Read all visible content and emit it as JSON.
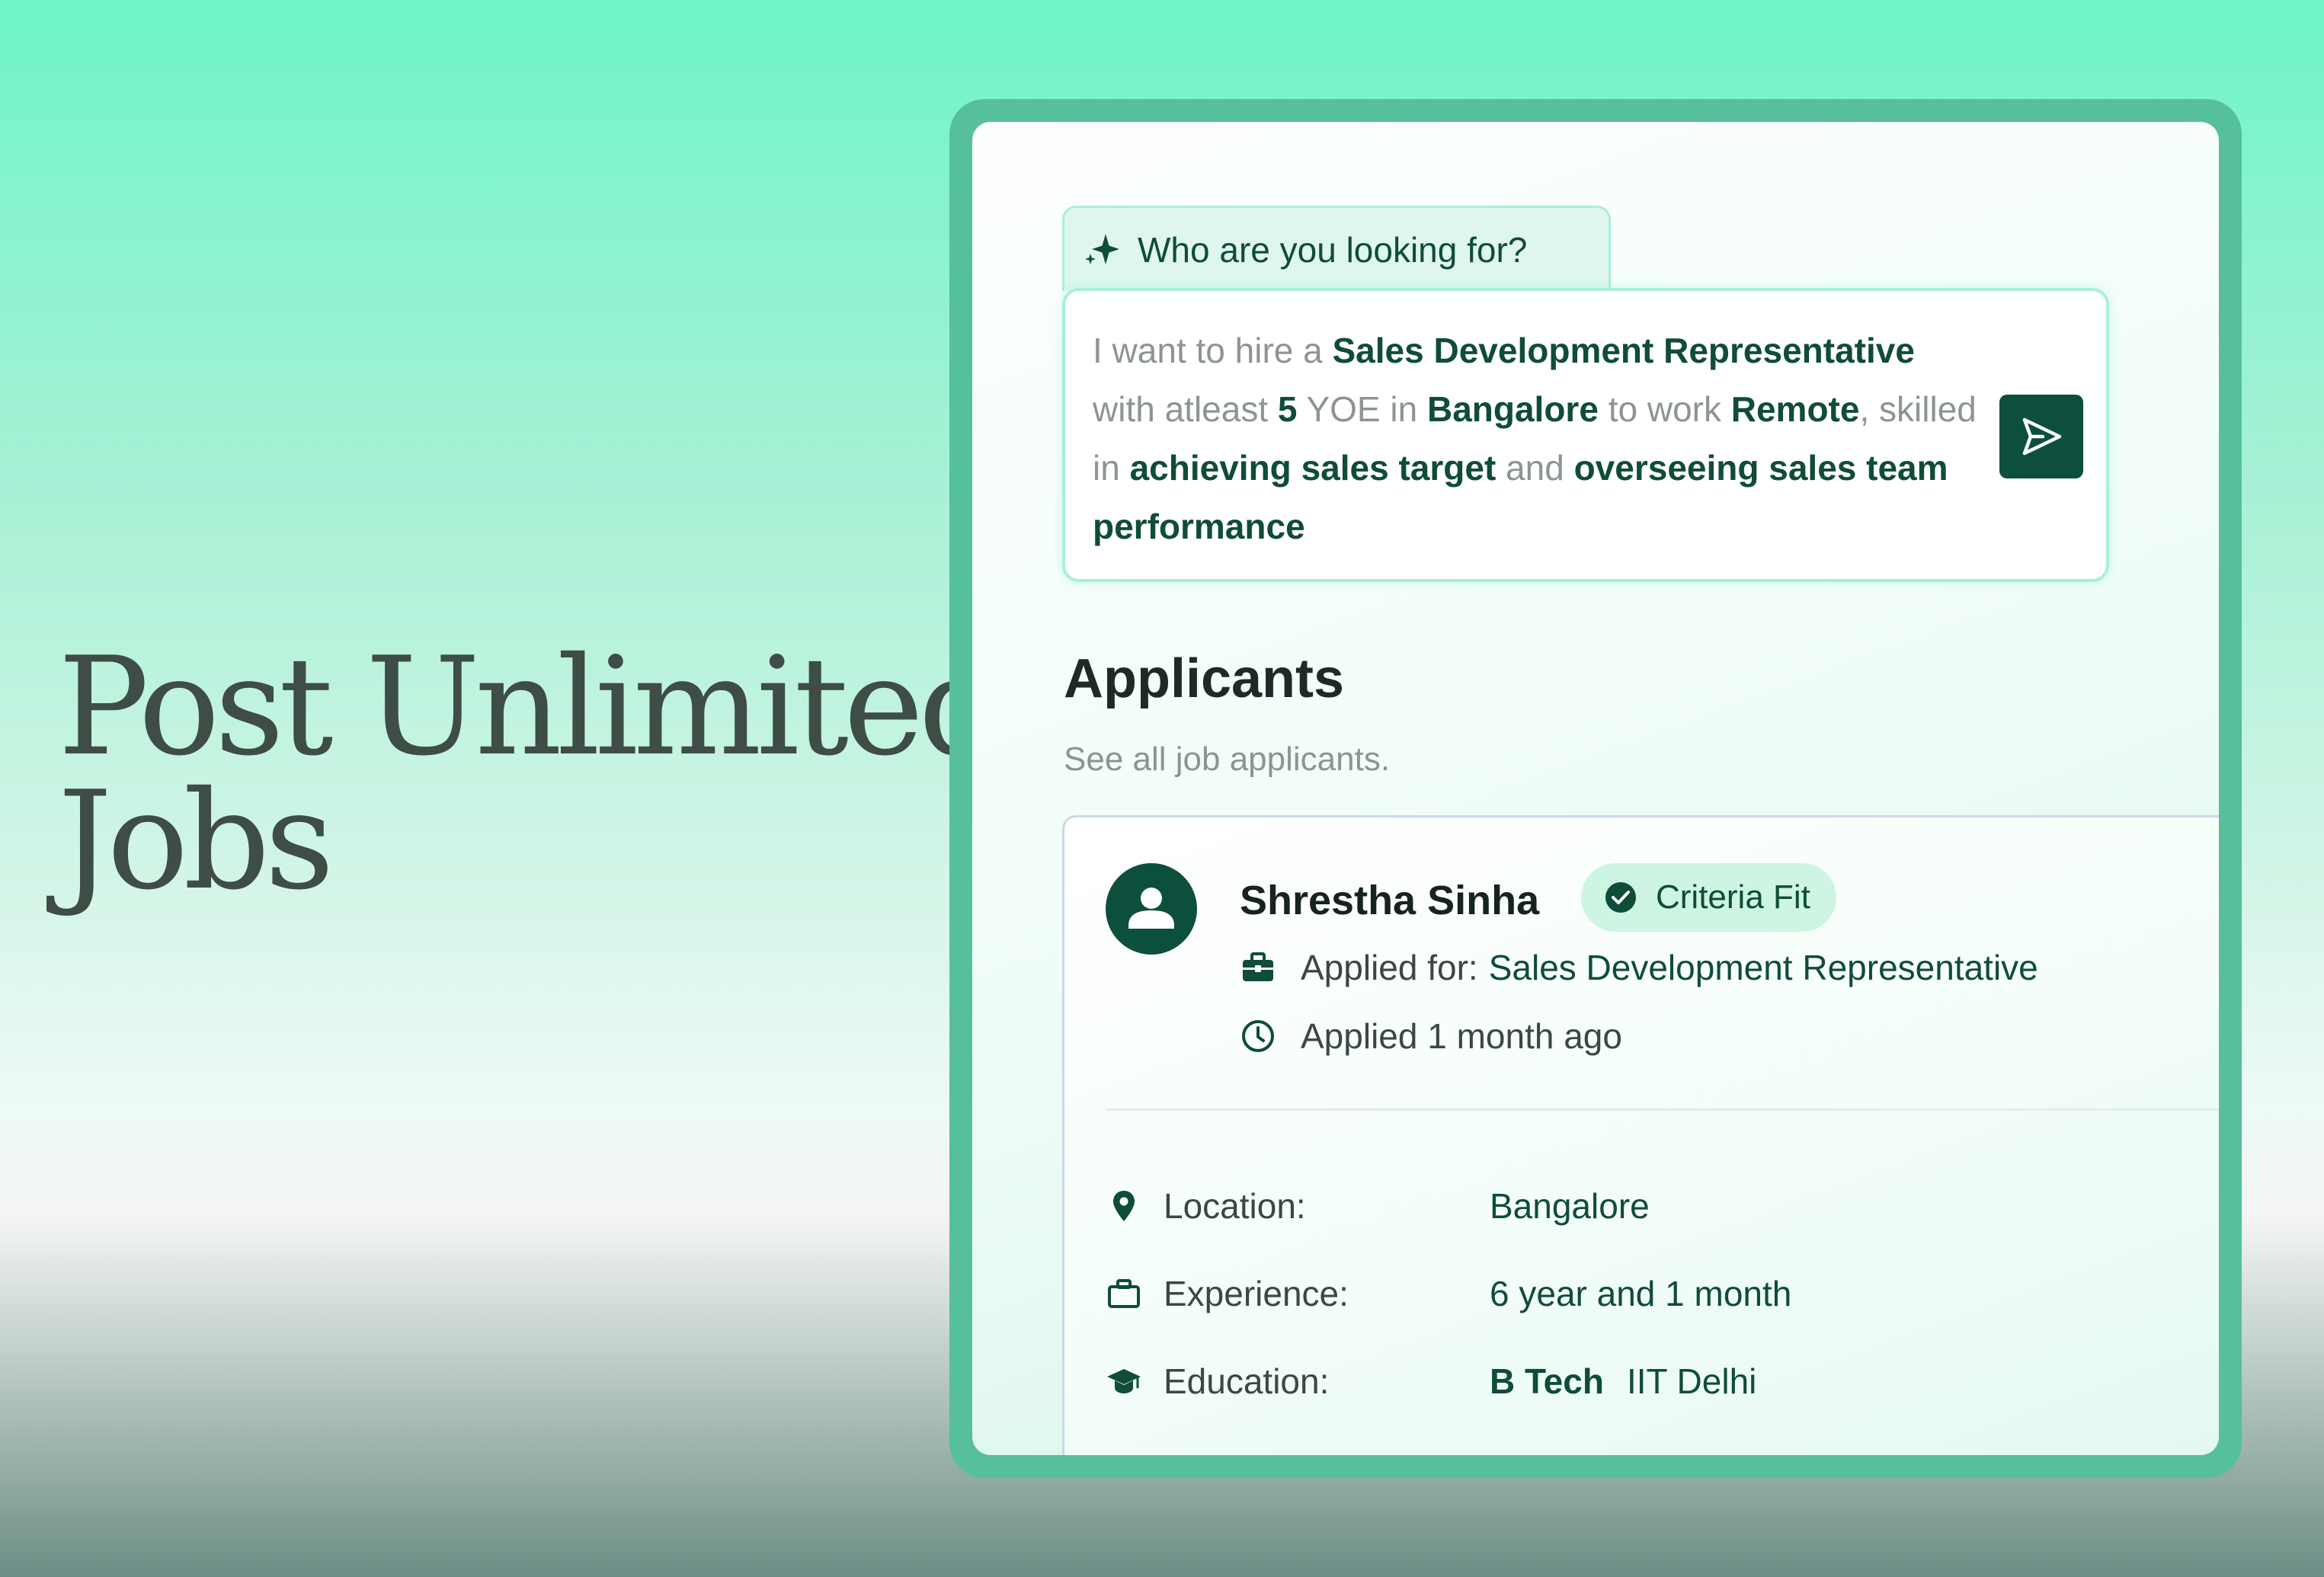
{
  "hero": {
    "line1": "Post Unlimited",
    "line2": "Jobs"
  },
  "prompt": {
    "tab_label": "Who are you looking for?",
    "segments": [
      {
        "text": "I want to hire a ",
        "bold": false
      },
      {
        "text": "Sales Development Representative",
        "bold": true
      },
      {
        "text": " with atleast ",
        "bold": false
      },
      {
        "text": "5",
        "bold": true
      },
      {
        "text": " YOE in ",
        "bold": false
      },
      {
        "text": "Bangalore",
        "bold": true
      },
      {
        "text": " to work ",
        "bold": false
      },
      {
        "text": "Remote",
        "bold": true
      },
      {
        "text": ", skilled in ",
        "bold": false
      },
      {
        "text": "achieving sales target",
        "bold": true
      },
      {
        "text": " and ",
        "bold": false
      },
      {
        "text": "overseeing sales team performance",
        "bold": true
      }
    ],
    "send_icon": "send-icon"
  },
  "applicants": {
    "title": "Applicants",
    "subtitle": "See all job applicants.",
    "card": {
      "name": "Shrestha Sinha",
      "badge": "Criteria Fit",
      "applied_for_label": "Applied for:",
      "applied_for_value": "Sales Development Representative",
      "applied_time": "Applied 1 month ago",
      "details": {
        "location_label": "Location:",
        "location_value": "Bangalore",
        "experience_label": "Experience:",
        "experience_value": "6 year and 1 month",
        "education_label": "Education:",
        "education_degree": "B Tech",
        "education_school": "IIT Delhi"
      }
    }
  },
  "colors": {
    "brand_dark": "#0c4f3c",
    "frame": "#56bf9e",
    "badge_bg": "#cdf5e2"
  }
}
